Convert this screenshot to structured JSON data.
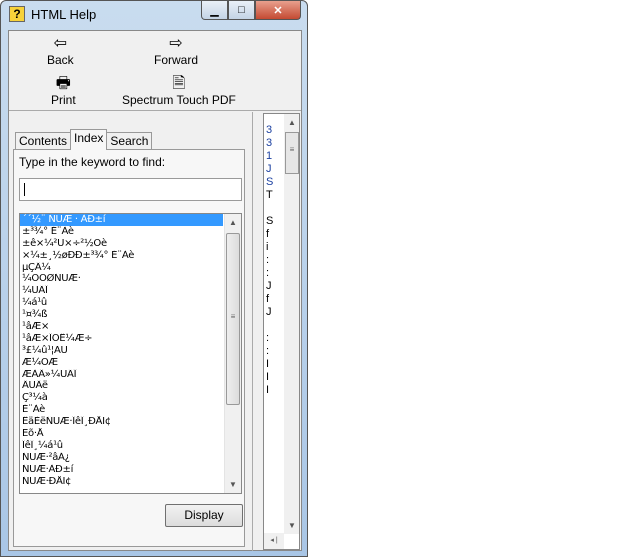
{
  "window": {
    "title": "HTML Help",
    "controls": {
      "minimize": "▁",
      "maximize": "□",
      "close": "✕"
    }
  },
  "toolbar": {
    "back": "Back",
    "forward": "Forward",
    "print": "Print",
    "pdf": "Spectrum Touch PDF"
  },
  "tabs": [
    {
      "label": "Contents"
    },
    {
      "label": "Index",
      "active": true
    },
    {
      "label": "Search"
    }
  ],
  "index": {
    "prompt": "Type in the keyword to find:",
    "keyword_value": "",
    "display_button": "Display",
    "items": [
      "´´½¨ ÑÙÆ · ÀÐ±í",
      "±³¾° É¨Àè",
      "±ê×¼²Ù×÷²½Öè",
      "×¼±¸½øÐÐ±³¾° É¨Àè",
      "µÇÂ¼",
      "¼ÓÔØÑÙÆ·",
      "¼ÙÃÎ",
      "¼á¹û",
      "¹¤¾ß",
      "¹âÆ×",
      "¹âÆ×ÎÓÊ¼Æ÷",
      "³£¼û¹¦ÄÜ",
      "Æ¼ÖÆ",
      "ÆÀÂ»¼ÙÃÎ",
      "ÂÜÂë",
      "Ç³¼à",
      "É¨Àè",
      "ÊäÈëÑÙÆ·ÎêÎ¸ÐÅÏ¢",
      "Ëõ·Å",
      "ÎêÎ¸¼á¹û",
      "ÑÙÆ·²âÁ¿",
      "ÑÙÆ·ÀÐ±í",
      "ÑÙÆ·ÐÅÏ¢"
    ],
    "selected_index": 0
  },
  "colors": {
    "selection": "#3399ff",
    "titlebar": "#b9d1ea",
    "close": "#c44a32"
  }
}
